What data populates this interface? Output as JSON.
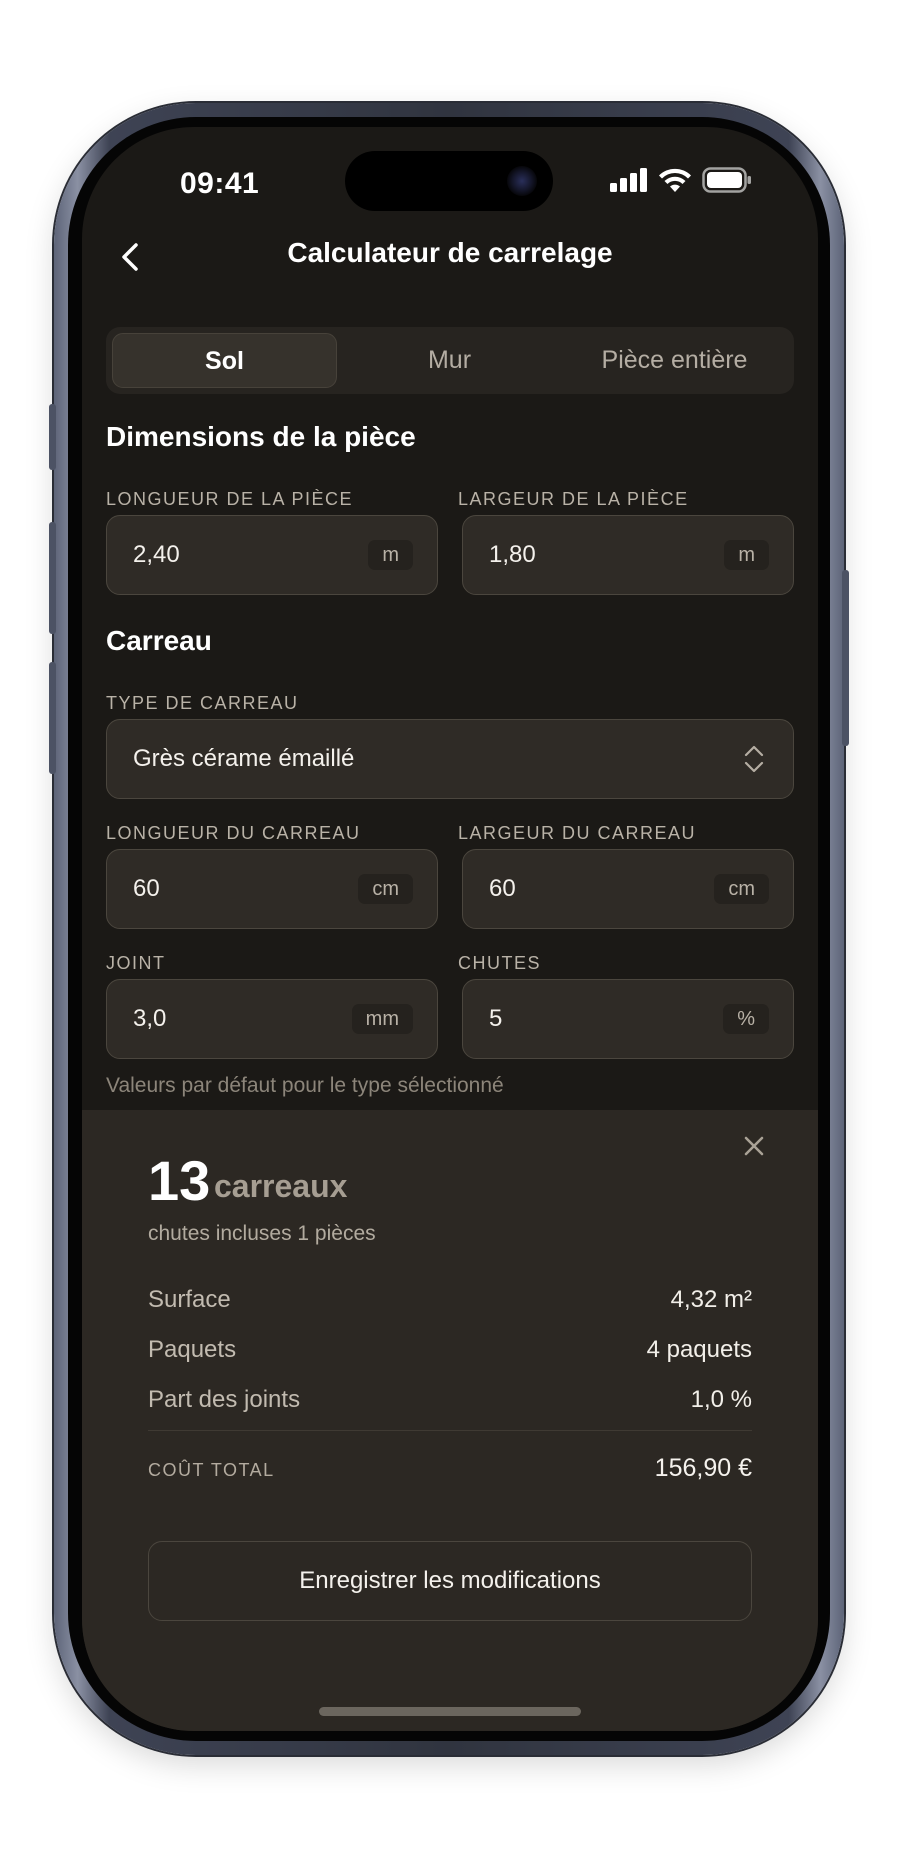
{
  "status_bar": {
    "time": "09:41"
  },
  "header": {
    "title": "Calculateur de carrelage"
  },
  "tabs": [
    {
      "label": "Sol",
      "active": true
    },
    {
      "label": "Mur",
      "active": false
    },
    {
      "label": "Pièce entière",
      "active": false
    }
  ],
  "room": {
    "title": "Dimensions de la pièce",
    "length": {
      "label": "LONGUEUR DE LA PIÈCE",
      "value": "2,40",
      "unit": "m"
    },
    "width": {
      "label": "LARGEUR DE LA PIÈCE",
      "value": "1,80",
      "unit": "m"
    }
  },
  "tile": {
    "title": "Carreau",
    "type": {
      "label": "TYPE DE CARREAU",
      "value": "Grès cérame émaillé"
    },
    "length": {
      "label": "LONGUEUR DU CARREAU",
      "value": "60",
      "unit": "cm"
    },
    "width": {
      "label": "LARGEUR DU CARREAU",
      "value": "60",
      "unit": "cm"
    },
    "joint": {
      "label": "JOINT",
      "value": "3,0",
      "unit": "mm"
    },
    "waste": {
      "label": "CHUTES",
      "value": "5",
      "unit": "%"
    },
    "hint": "Valeurs par défaut pour le type sélectionné"
  },
  "result": {
    "count": "13",
    "count_unit": "carreaux",
    "subtitle": "chutes incluses 1 pièces",
    "rows": [
      {
        "label": "Surface",
        "value": "4,32 m²"
      },
      {
        "label": "Paquets",
        "value": "4 paquets"
      },
      {
        "label": "Part des joints",
        "value": "1,0 %"
      }
    ],
    "total_label": "COÛT TOTAL",
    "total_value": "156,90 €",
    "save_label": "Enregistrer les modifications"
  },
  "colors": {
    "background": "#1b1916",
    "sheet": "#2c2823",
    "input": "#2f2b26",
    "accent_text": "#ffffff",
    "muted_text": "#b9b2a7"
  }
}
